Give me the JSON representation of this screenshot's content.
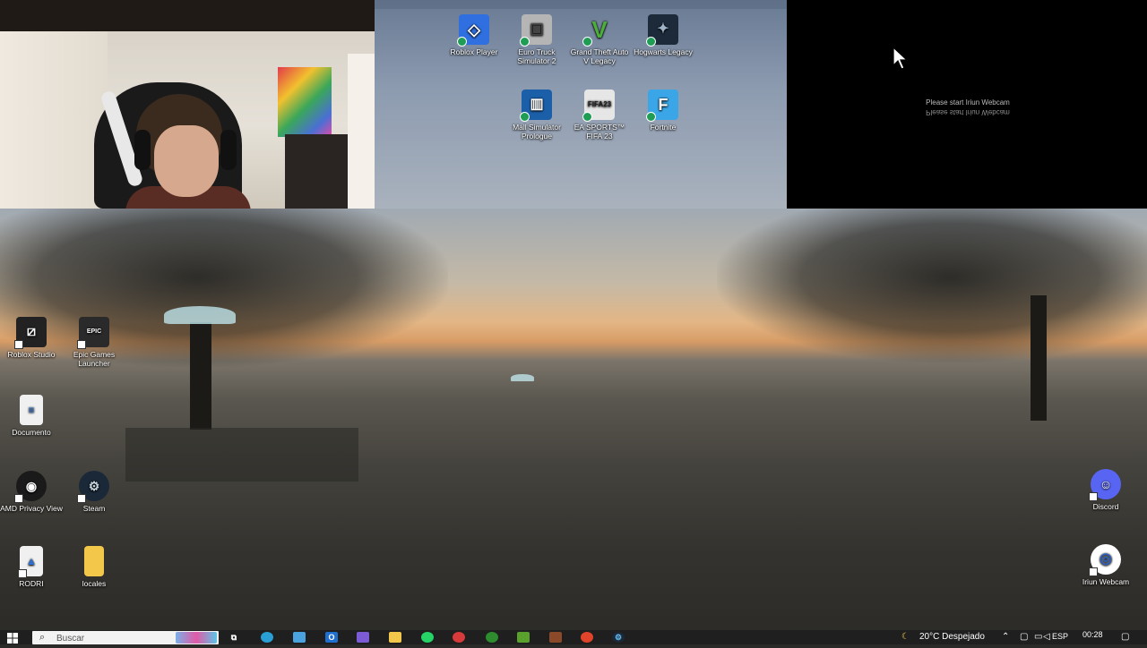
{
  "webcam_overlay": {
    "message_line1": "Please start Iriun Webcam",
    "message_line2": "Please start Iriun Webcam"
  },
  "desktop": {
    "top_icons": [
      {
        "label": "Roblox Player",
        "icon": "roblox-player-icon",
        "color": "#2f6fe0"
      },
      {
        "label": "Euro Truck Simulator 2",
        "icon": "euro-truck-icon",
        "color": "#c9c9c9"
      },
      {
        "label": "Grand Theft Auto V Legacy",
        "icon": "gta-v-icon",
        "color": "#4a8a3a"
      },
      {
        "label": "Hogwarts Legacy",
        "icon": "hogwarts-icon",
        "color": "#1d2a3a"
      },
      {
        "label": "Mall Simulator Prologue",
        "icon": "mall-simulator-icon",
        "color": "#1b5fa8"
      },
      {
        "label": "EA SPORTS™ FIFA 23",
        "icon": "fifa-23-icon",
        "color": "#e6e6e6"
      },
      {
        "label": "Fortnite",
        "icon": "fortnite-icon",
        "color": "#3aa6e8"
      }
    ],
    "left_icons": [
      {
        "label": "Roblox Studio",
        "icon": "roblox-studio-icon",
        "color": "#222"
      },
      {
        "label": "Epic Games Launcher",
        "icon": "epic-games-icon",
        "color": "#2a2a2a"
      },
      {
        "label": "Documento",
        "icon": "document-icon",
        "color": "#f0f0f0"
      },
      {
        "label": "AMD Privacy View",
        "icon": "amd-privacy-icon",
        "color": "#1a1a1a"
      },
      {
        "label": "Steam",
        "icon": "steam-icon",
        "color": "#1b2838"
      },
      {
        "label": "RODRI",
        "icon": "image-file-icon",
        "color": "#f0f0f0"
      },
      {
        "label": "locales",
        "icon": "folder-icon",
        "color": "#f3c84a"
      }
    ],
    "right_icons": [
      {
        "label": "Discord",
        "icon": "discord-icon",
        "color": "#5865f2"
      },
      {
        "label": "Iriun Webcam",
        "icon": "iriun-webcam-icon",
        "color": "#2a5fc0"
      }
    ]
  },
  "taskbar": {
    "search_placeholder": "Buscar",
    "weather": "20°C  Despejado",
    "language": "ESP",
    "time": "00:28",
    "apps": [
      {
        "name": "task-view",
        "color": "#ffffff"
      },
      {
        "name": "edge",
        "color": "#2a9fd6"
      },
      {
        "name": "store",
        "color": "#4aa3df"
      },
      {
        "name": "outlook",
        "color": "#1f6fd1"
      },
      {
        "name": "copilot",
        "color": "#7b5cd6"
      },
      {
        "name": "file-explorer",
        "color": "#f3c84a"
      },
      {
        "name": "whatsapp",
        "color": "#25d366"
      },
      {
        "name": "davinci",
        "color": "#d63a3a"
      },
      {
        "name": "xbox",
        "color": "#2e8b2e"
      },
      {
        "name": "minecraft",
        "color": "#5aa02c"
      },
      {
        "name": "minecraft-launcher",
        "color": "#8a4a2a"
      },
      {
        "name": "chrome",
        "color": "#e0452b"
      },
      {
        "name": "steam",
        "color": "#66c0f4"
      }
    ]
  }
}
